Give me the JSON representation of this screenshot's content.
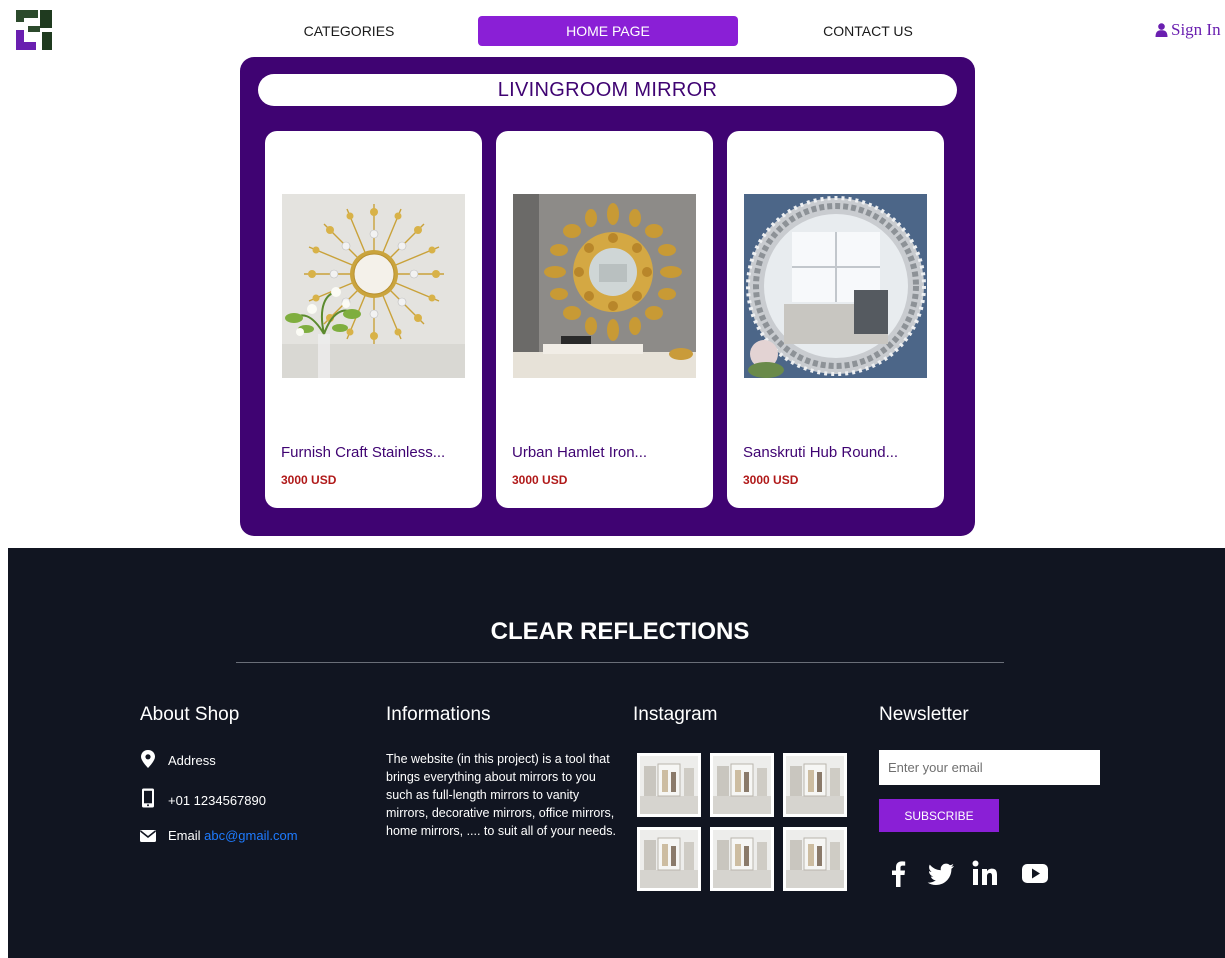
{
  "header": {
    "nav": [
      "CATEGORIES",
      "HOME PAGE",
      "CONTACT US"
    ],
    "signin_label": "Sign In"
  },
  "section": {
    "title": "LIVINGROOM MIRROR",
    "products": [
      {
        "name": "Furnish Craft Stainless...",
        "price": "3000 USD",
        "image": "sunburst-mirror"
      },
      {
        "name": "Urban Hamlet Iron...",
        "price": "3000 USD",
        "image": "leaf-mirror"
      },
      {
        "name": "Sanskruti Hub Round...",
        "price": "3000 USD",
        "image": "crystal-round-mirror"
      }
    ]
  },
  "footer": {
    "brand": "CLEAR REFLECTIONS",
    "about": {
      "title": "About Shop",
      "address": "Address",
      "phone": "+01 1234567890",
      "email_label": "Email",
      "email": "abc@gmail.com"
    },
    "info": {
      "title": "Informations",
      "text": "The website (in this project) is a tool that brings everything about mirrors to you such as full-length mirrors to vanity mirrors, decorative mirrors, office mirrors, home mirrors, .... to suit all of your needs."
    },
    "instagram": {
      "title": "Instagram",
      "tiles": 6
    },
    "newsletter": {
      "title": "Newsletter",
      "placeholder": "Enter your email",
      "button": "SUBSCRIBE"
    },
    "social": [
      "facebook-icon",
      "twitter-icon",
      "linkedin-icon",
      "youtube-icon"
    ]
  },
  "colors": {
    "accent": "#8a1fd6",
    "panel": "#3f0372",
    "price": "#b01919",
    "footer_bg": "#111521",
    "link": "#1e7bff"
  }
}
